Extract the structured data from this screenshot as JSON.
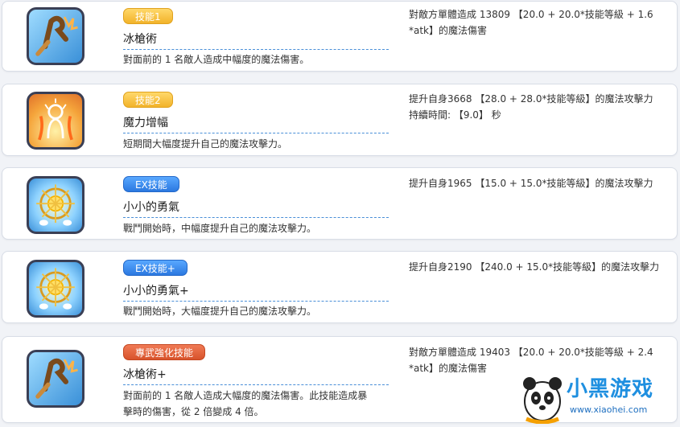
{
  "skills": [
    {
      "tag": "技能1",
      "tag_color": "yellow",
      "name": "冰槍術",
      "desc_lines": [
        "對面前的 1 名敵人造成中幅度的魔法傷害。"
      ],
      "effect_lines": [
        "對敵方單體造成 13809 【20.0 + 20.0*技能等級 + 1.6",
        "*atk】的魔法傷害"
      ],
      "icon": "ice-spear-icon"
    },
    {
      "tag": "技能2",
      "tag_color": "yellow",
      "name": "魔力增幅",
      "desc_lines": [
        "短期間大幅度提升自己的魔法攻擊力。"
      ],
      "effect_lines": [
        "提升自身3668 【28.0 + 28.0*技能等級】的魔法攻擊力",
        "持續時間: 【9.0】 秒"
      ],
      "icon": "magic-boost-icon"
    },
    {
      "tag": "EX技能",
      "tag_color": "blue",
      "name": "小小的勇氣",
      "desc_lines": [
        "戰鬥開始時，中幅度提升自己的魔法攻擊力。"
      ],
      "effect_lines": [
        "提升自身1965 【15.0 + 15.0*技能等級】的魔法攻擊力"
      ],
      "icon": "courage-sun-icon"
    },
    {
      "tag": "EX技能+",
      "tag_color": "blue",
      "name": "小小的勇氣+",
      "desc_lines": [
        "戰鬥開始時，大幅度提升自己的魔法攻擊力。"
      ],
      "effect_lines": [
        "提升自身2190 【240.0 + 15.0*技能等級】的魔法攻擊力"
      ],
      "icon": "courage-sun-icon"
    },
    {
      "tag": "專武強化技能",
      "tag_color": "red",
      "name": "冰槍術+",
      "desc_lines": [
        "對面前的 1 名敵人造成大幅度的魔法傷害。此技能造成暴",
        "擊時的傷害，從 2 倍變成 4 倍。"
      ],
      "effect_lines": [
        "對敵方單體造成 19403 【20.0 + 20.0*技能等級 + 2.4",
        "*atk】的魔法傷害"
      ],
      "icon": "ice-spear-icon"
    }
  ],
  "watermark": {
    "brand": "小黑游戏",
    "url": "www.xiaohei.com"
  },
  "colors": {
    "yellow_tag": "#f2b32a",
    "blue_tag": "#2b78e0",
    "red_tag": "#d8532b",
    "dashed_line": "#4a8fd8"
  }
}
